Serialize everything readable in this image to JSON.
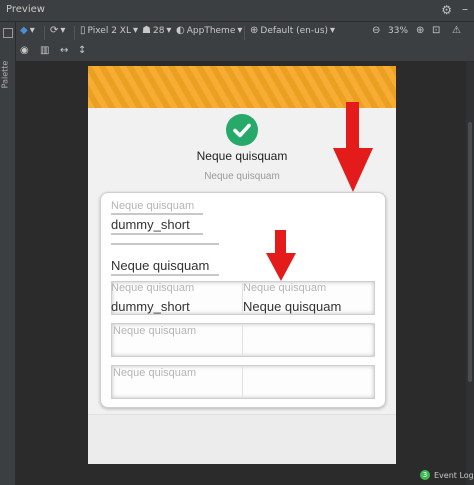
{
  "window": {
    "title": "Preview"
  },
  "sidebar": {
    "palette_label": "Palette"
  },
  "toolbar": {
    "device": "Pixel 2 XL",
    "api": "28",
    "theme": "AppTheme",
    "locale": "Default (en-us)",
    "zoom": "33%"
  },
  "screen": {
    "heading": "Neque quisquam",
    "subheading": "Neque quisquam",
    "card": {
      "field1": {
        "label": "Neque quisquam",
        "value": "dummy_short"
      },
      "field2": {
        "label": "",
        "value": "Neque quisquam"
      },
      "row1": {
        "left": {
          "label": "Neque quisquam",
          "value": "dummy_short"
        },
        "right": {
          "label": "Neque quisquam",
          "value": "Neque quisquam"
        }
      },
      "row2": {
        "left_label": "Neque quisquam"
      },
      "row3": {
        "left_label": "Neque quisquam"
      }
    }
  },
  "status": {
    "event_count": "3",
    "event_log": "Event Log"
  },
  "colors": {
    "appbar": "#f6a623",
    "check": "#27a96a",
    "arrow": "#e31b1b"
  }
}
